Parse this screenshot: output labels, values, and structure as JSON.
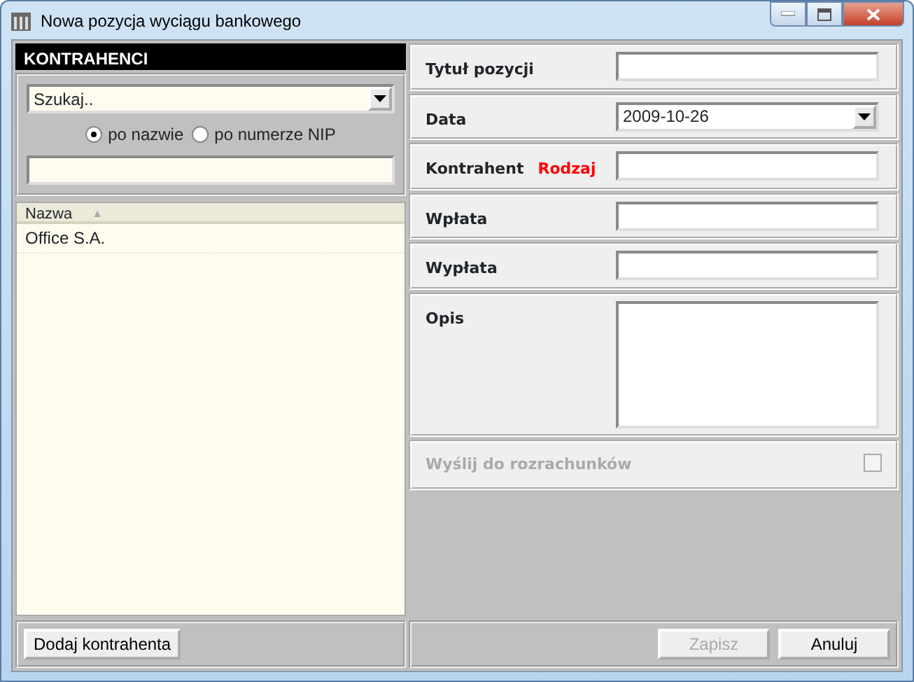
{
  "window": {
    "title": "Nowa pozycja wyciągu bankowego"
  },
  "contractors": {
    "title": "KONTRAHENCI",
    "search_combo": {
      "value": "Szukaj.."
    },
    "search_modes": [
      {
        "label": "po nazwie",
        "selected": true
      },
      {
        "label": "po numerze NIP",
        "selected": false
      }
    ],
    "table": {
      "columns": [
        {
          "label": "Nazwa",
          "sort": "▲"
        }
      ],
      "rows": [
        {
          "name": "Office S.A."
        }
      ]
    },
    "add_button": {
      "label": "Dodaj kontrahenta"
    }
  },
  "form": {
    "fields": [
      {
        "kind": "text",
        "label": "Tytuł pozycji"
      },
      {
        "kind": "combo",
        "label": "Data",
        "value": "2009-10-26"
      },
      {
        "kind": "text",
        "label": "Kontrahent",
        "extra_label": "Rodzaj"
      },
      {
        "kind": "text",
        "label": "Wpłata"
      },
      {
        "kind": "text",
        "label": "Wypłata"
      },
      {
        "kind": "textarea",
        "label": "Opis"
      }
    ],
    "send_option": {
      "label": "Wyślij do rozrachunków",
      "checked": false,
      "disabled": true
    }
  },
  "buttons": [
    {
      "label": "Zapisz",
      "disabled": true
    },
    {
      "label": "Anuluj",
      "disabled": false
    }
  ]
}
